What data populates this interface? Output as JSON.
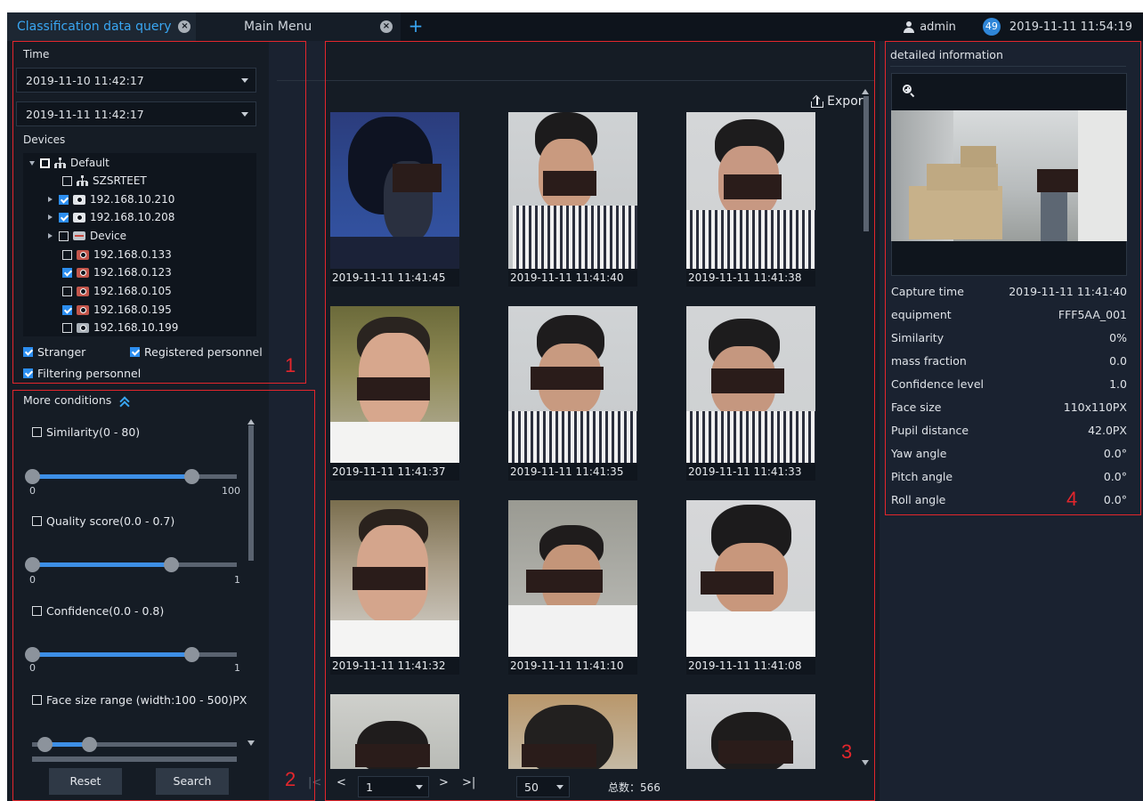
{
  "tabs": [
    {
      "label": "Classification data query"
    },
    {
      "label": "Main Menu"
    }
  ],
  "header": {
    "user": "admin",
    "badge_count": "49",
    "datetime": "2019-11-11 11:54:19"
  },
  "left": {
    "time_label": "Time",
    "start_time": "2019-11-10 11:42:17",
    "end_time": "2019-11-11 11:42:17",
    "devices_label": "Devices",
    "tree": [
      {
        "label": "Default",
        "icon": "network-icon",
        "checked": false
      },
      {
        "label": "SZSRTEET",
        "icon": "network-icon",
        "checked": false
      },
      {
        "label": "192.168.10.210",
        "icon": "camera-icon",
        "checked": true
      },
      {
        "label": "192.168.10.208",
        "icon": "camera-icon",
        "checked": true
      },
      {
        "label": "Device",
        "icon": "device-icon",
        "checked": false
      },
      {
        "label": "192.168.0.133",
        "icon": "camera-icon",
        "checked": false
      },
      {
        "label": "192.168.0.123",
        "icon": "camera-icon",
        "checked": true
      },
      {
        "label": "192.168.0.105",
        "icon": "camera-icon",
        "checked": false
      },
      {
        "label": "192.168.0.195",
        "icon": "camera-icon",
        "checked": true
      },
      {
        "label": "192.168.10.199",
        "icon": "camera-icon",
        "checked": false
      }
    ],
    "stranger": "Stranger",
    "registered": "Registered personnel",
    "filtering": "Filtering personnel"
  },
  "conditions": {
    "title": "More conditions",
    "similarity": {
      "label": "Similarity(0 - 80)",
      "min": "0",
      "max": "100",
      "low": 0,
      "high": 80
    },
    "quality": {
      "label": "Quality score(0.0 - 0.7)",
      "min": "0",
      "max": "1",
      "low": 0.0,
      "high": 0.7
    },
    "confidence": {
      "label": "Confidence(0.0 - 0.8)",
      "min": "0",
      "max": "1",
      "low": 0.0,
      "high": 0.8
    },
    "face_size": {
      "label": "Face size range (width:100 - 500)PX"
    },
    "reset": "Reset",
    "search": "Search"
  },
  "center": {
    "export": "Export",
    "captures": [
      "2019-11-11 11:41:45",
      "2019-11-11 11:41:40",
      "2019-11-11 11:41:38",
      "2019-11-11 11:41:37",
      "2019-11-11 11:41:35",
      "2019-11-11 11:41:33",
      "2019-11-11 11:41:32",
      "2019-11-11 11:41:10",
      "2019-11-11 11:41:08"
    ],
    "page": "1",
    "page_size": "50",
    "total": "总数：566"
  },
  "details": {
    "title": "detailed information",
    "rows": [
      {
        "key": "Capture time",
        "value": "2019-11-11 11:41:40"
      },
      {
        "key": "equipment",
        "value": "FFF5AA_001"
      },
      {
        "key": "Similarity",
        "value": "0%"
      },
      {
        "key": "mass fraction",
        "value": "0.0"
      },
      {
        "key": "Confidence level",
        "value": "1.0"
      },
      {
        "key": "Face size",
        "value": "110x110PX"
      },
      {
        "key": "Pupil distance",
        "value": "42.0PX"
      },
      {
        "key": "Yaw angle",
        "value": "0.0°"
      },
      {
        "key": "Pitch angle",
        "value": "0.0°"
      },
      {
        "key": "Roll angle",
        "value": "0.0°"
      }
    ]
  },
  "annotations": [
    "1",
    "2",
    "3",
    "4"
  ],
  "colors": {
    "accent": "#39a6f2",
    "annotation": "#e3262c",
    "panel": "#151c25"
  }
}
